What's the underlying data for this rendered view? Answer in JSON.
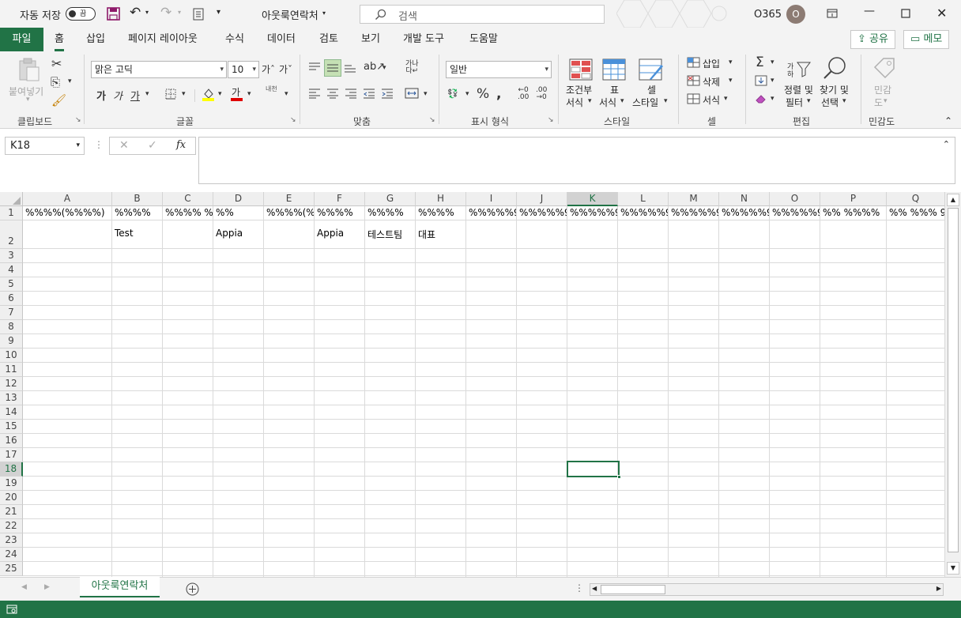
{
  "titlebar": {
    "autosave_label": "자동 저장",
    "autosave_state": "끔",
    "doc_title": "아웃룩연락처",
    "search_placeholder": "검색",
    "account": "O365",
    "avatar_initial": "O"
  },
  "tabs": {
    "file": "파일",
    "items": [
      "홈",
      "삽입",
      "페이지 레이아웃",
      "수식",
      "데이터",
      "검토",
      "보기",
      "개발 도구",
      "도움말"
    ],
    "share": "공유",
    "comments": "메모"
  },
  "ribbon": {
    "clipboard": {
      "paste": "붙여넣기",
      "label": "클립보드"
    },
    "font": {
      "name": "맑은 고딕",
      "size": "10",
      "label": "글꼴",
      "bold": "가",
      "italic": "가",
      "underline": "가",
      "phonetic": "내천"
    },
    "alignment": {
      "label": "맞춤"
    },
    "number": {
      "format": "일반",
      "label": "표시 형식"
    },
    "styles": {
      "conditional_1": "조건부",
      "conditional_2": "서식",
      "table_1": "표",
      "table_2": "서식",
      "cell_1": "셀",
      "cell_2": "스타일",
      "label": "스타일"
    },
    "cells": {
      "insert": "삽입",
      "delete": "삭제",
      "format": "서식",
      "label": "셀"
    },
    "editing": {
      "sort_1": "정렬 및",
      "sort_2": "필터",
      "find_1": "찾기 및",
      "find_2": "선택",
      "label": "편집"
    },
    "sensitivity": {
      "line1": "민감",
      "line2": "도",
      "label": "민감도"
    }
  },
  "formula_bar": {
    "name_box": "K18",
    "fx": "fx",
    "formula": ""
  },
  "sheet": {
    "columns": [
      "A",
      "B",
      "C",
      "D",
      "E",
      "F",
      "G",
      "H",
      "I",
      "J",
      "K",
      "L",
      "M",
      "N",
      "O",
      "P",
      "Q"
    ],
    "selected_column": "K",
    "rows": [
      "1",
      "2",
      "3",
      "4",
      "5",
      "6",
      "7",
      "8",
      "9",
      "10",
      "11",
      "12",
      "13",
      "14",
      "15",
      "16",
      "17",
      "18",
      "19",
      "20",
      "21",
      "22",
      "23",
      "24",
      "25"
    ],
    "selected_row": "18",
    "row1": [
      "%%%%(%%%%)",
      "%%%%",
      "%%%% %",
      "%%",
      "%%%%(%(",
      "%%%%",
      "%%%%",
      "%%%%",
      "%%%%%9",
      "%%%%%9",
      "%%%%%9",
      "%%%%%9",
      "%%%%%9",
      "%%%%%9",
      "%%%%%9",
      "%% %%%%",
      "%% %%% 9"
    ],
    "row2": [
      "",
      "Test",
      "",
      "Appia",
      "",
      "Appia",
      "테스트팀",
      "대표",
      "",
      "",
      "",
      "",
      "",
      "",
      "",
      "",
      ""
    ]
  },
  "sheet_tabs": {
    "active": "아웃룩연락처"
  }
}
